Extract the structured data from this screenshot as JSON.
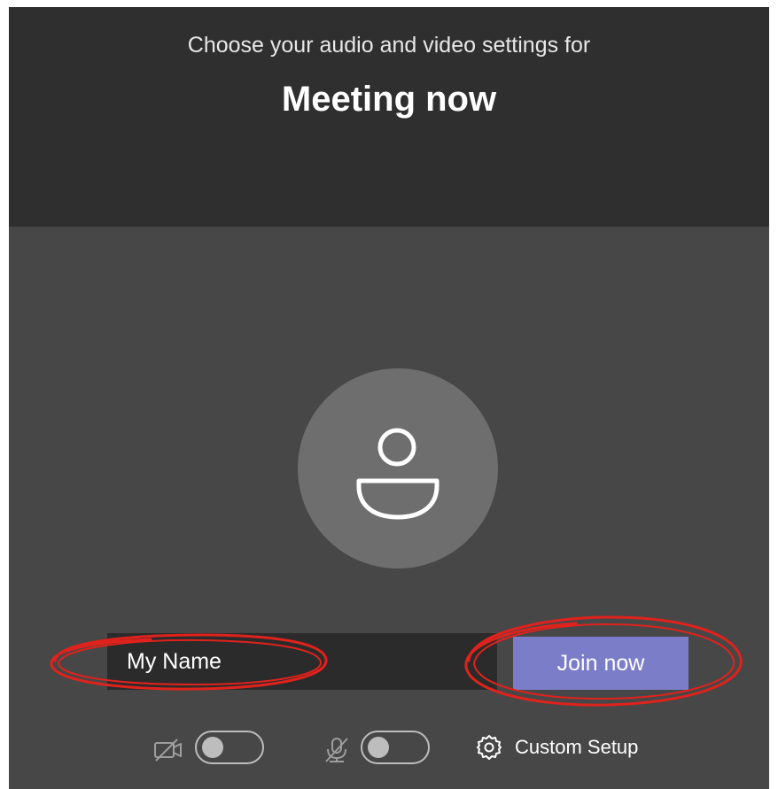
{
  "header": {
    "subtitle": "Choose your audio and video settings for",
    "title": "Meeting now"
  },
  "avatar": {
    "icon": "person-icon"
  },
  "name_input": {
    "value": "My Name"
  },
  "join_button": {
    "label": "Join now"
  },
  "controls": {
    "camera": {
      "icon": "camera-off-icon",
      "state": "off"
    },
    "microphone": {
      "icon": "mic-off-icon",
      "state": "off"
    },
    "custom_setup": {
      "icon": "gear-icon",
      "label": "Custom Setup"
    }
  },
  "colors": {
    "header_bg": "#2f2f2f",
    "body_bg": "#474747",
    "accent": "#7b7dc8",
    "annotation": "#e0221c"
  }
}
